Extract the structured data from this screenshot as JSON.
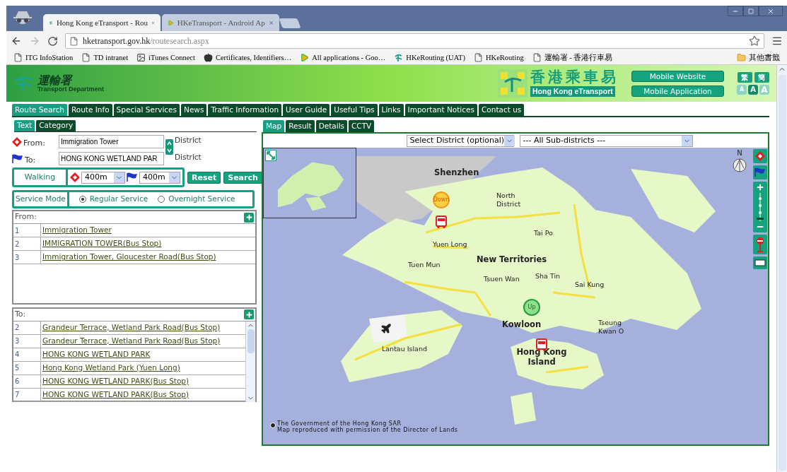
{
  "browser": {
    "tabs": [
      {
        "title": "Hong Kong eTransport - Rou",
        "selected": true
      },
      {
        "title": "HKeTransport - Android Ap",
        "selected": false
      }
    ],
    "url_host": "hketransport.gov.hk",
    "url_path": "/routesearch.aspx",
    "bookmarks": [
      {
        "label": "ITG InfoStation",
        "kind": "page"
      },
      {
        "label": "TD intranet",
        "kind": "page"
      },
      {
        "label": "iTunes Connect",
        "kind": "app"
      },
      {
        "label": "Certificates, Identifiers…",
        "kind": "apple"
      },
      {
        "label": "All applications - Goo…",
        "kind": "play"
      },
      {
        "label": "HKeRouting (UAT)",
        "kind": "logo"
      },
      {
        "label": "HKeRouting",
        "kind": "page"
      },
      {
        "label": "運輸署 - 香港行車易",
        "kind": "page"
      }
    ],
    "other_bookmarks": "其他書籤"
  },
  "header": {
    "logo_zh": "運輸署",
    "logo_en": "Transport Department",
    "brand_zh": "香港乘車易",
    "brand_en": "Hong Kong eTransport",
    "links": [
      "Mobile Website",
      "Mobile Application"
    ],
    "languages": [
      "繁",
      "簡"
    ],
    "font_sizes": [
      {
        "label": "A",
        "selected": false
      },
      {
        "label": "A",
        "selected": true
      },
      {
        "label": "A",
        "selected": false
      }
    ]
  },
  "nav": [
    {
      "label": "Route Search",
      "selected": true
    },
    {
      "label": "Route Info",
      "selected": false
    },
    {
      "label": "Special Services",
      "selected": false
    },
    {
      "label": "News",
      "selected": false
    },
    {
      "label": "Traffic Information",
      "selected": false
    },
    {
      "label": "User Guide",
      "selected": false
    },
    {
      "label": "Useful Tips",
      "selected": false
    },
    {
      "label": "Links",
      "selected": false
    },
    {
      "label": "Important Notices",
      "selected": false
    },
    {
      "label": "Contact us",
      "selected": false
    }
  ],
  "search_tabs": [
    {
      "label": "Text",
      "selected": true
    },
    {
      "label": "Category",
      "selected": false
    }
  ],
  "from": {
    "label": "From:",
    "value": "Immigration Tower",
    "district": "District"
  },
  "to": {
    "label": "To:",
    "value": "HONG KONG WETLAND PAR",
    "district": "District"
  },
  "walking": {
    "label": "Walking",
    "from_distance": "400m",
    "to_distance": "400m"
  },
  "actions": [
    "Reset",
    "Search"
  ],
  "service_mode": {
    "label": "Service Mode",
    "options": [
      {
        "label": "Regular Service",
        "selected": true
      },
      {
        "label": "Overnight Service",
        "selected": false
      }
    ]
  },
  "from_results": {
    "title": "From:",
    "rows": [
      {
        "index": "1",
        "name": "Immigration Tower"
      },
      {
        "index": "2",
        "name": "IMMIGRATION TOWER(Bus Stop)"
      },
      {
        "index": "3",
        "name": "Immigration Tower, Gloucester Road(Bus Stop)"
      }
    ]
  },
  "to_results": {
    "title": "To:",
    "rows": [
      {
        "index": "2",
        "name": "Grandeur Terrace, Wetland Park Road(Bus Stop)"
      },
      {
        "index": "3",
        "name": "Grandeur Terrace, Wetland Park Road(Bus Stop)"
      },
      {
        "index": "4",
        "name": "HONG KONG WETLAND PARK"
      },
      {
        "index": "5",
        "name": "Hong Kong Wetland Park (Yuen Long)"
      },
      {
        "index": "6",
        "name": "HONG KONG WETLAND PARK(Bus Stop)"
      },
      {
        "index": "7",
        "name": "HONG KONG WETLAND PARK(Bus Stop)"
      }
    ]
  },
  "map_tabs": [
    {
      "label": "Map",
      "selected": true
    },
    {
      "label": "Result",
      "selected": false
    },
    {
      "label": "Details",
      "selected": false
    },
    {
      "label": "CCTV",
      "selected": false
    }
  ],
  "district_select": "Select District (optional)",
  "subdistrict_select": "--- All Sub-districts ---",
  "map": {
    "labels": [
      {
        "text": "Shenzhen",
        "kind": "region"
      },
      {
        "text": "North District",
        "kind": "place"
      },
      {
        "text": "Tai Po",
        "kind": "place"
      },
      {
        "text": "New Territories",
        "kind": "region"
      },
      {
        "text": "Yuen Long",
        "kind": "place"
      },
      {
        "text": "Tuen Mun",
        "kind": "place"
      },
      {
        "text": "Tsuen Wan",
        "kind": "place"
      },
      {
        "text": "Sha Tin",
        "kind": "place"
      },
      {
        "text": "Sai Kung",
        "kind": "place"
      },
      {
        "text": "Kowloon",
        "kind": "region"
      },
      {
        "text": "Tseung Kwan O",
        "kind": "place"
      },
      {
        "text": "Lantau Island",
        "kind": "place"
      },
      {
        "text": "Hong Kong Island",
        "kind": "region"
      }
    ],
    "markers": [
      {
        "label": "Down",
        "kind": "origin"
      },
      {
        "label": "Up",
        "kind": "destination"
      }
    ],
    "compass": "N",
    "copyright": [
      "The Government of the Hong Kong SAR",
      "Map reproduced with permission of the Director of Lands"
    ]
  }
}
